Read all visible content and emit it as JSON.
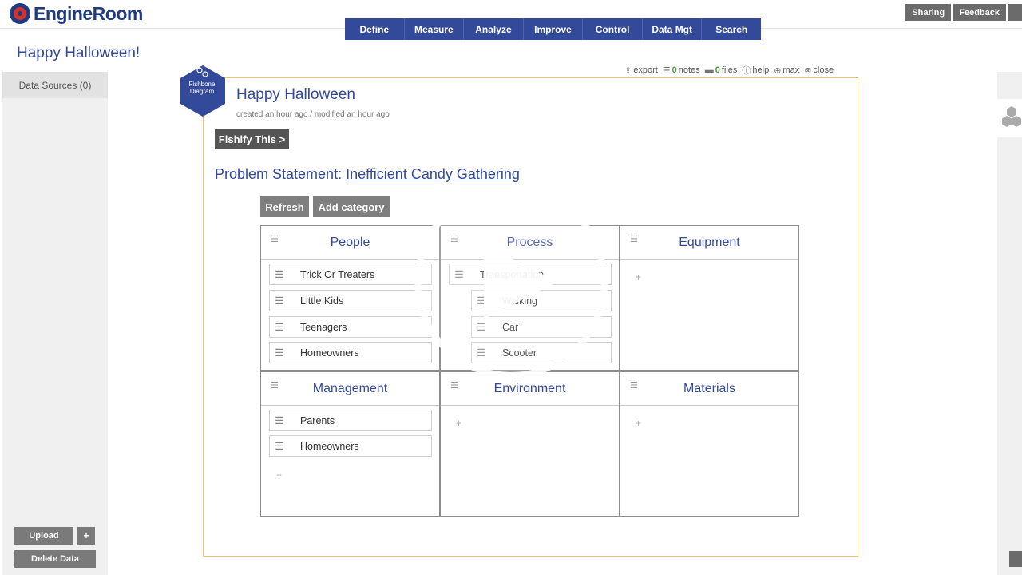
{
  "app": {
    "name": "EngineRoom"
  },
  "header": {
    "right_buttons": [
      "Sharing",
      "Feedback",
      ""
    ],
    "nav": [
      "Define",
      "Measure",
      "Analyze",
      "Improve",
      "Control",
      "Data Mgt",
      "Search"
    ]
  },
  "page": {
    "title": "Happy Halloween!"
  },
  "left_panel": {
    "header": "Data Sources (0)",
    "upload_label": "Upload",
    "plus_label": "+",
    "delete_label": "Delete Data"
  },
  "toolbar": {
    "export": "export",
    "notes_count": "0",
    "notes": "notes",
    "files_count": "0",
    "files": "files",
    "help": "help",
    "max": "max",
    "close": "close"
  },
  "document": {
    "badge_line1": "Fishbone",
    "badge_line2": "Diagram",
    "title": "Happy Halloween",
    "meta": "created an hour ago / modified an hour ago",
    "fishify_label": "Fishify This >",
    "problem_prefix": "Problem Statement:",
    "problem_text": "Inefficient Candy Gathering",
    "refresh_label": "Refresh",
    "add_category_label": "Add category"
  },
  "categories": [
    {
      "name": "People",
      "causes": [
        "Trick Or Treaters",
        "Little Kids",
        "Teenagers",
        "Homeowners"
      ]
    },
    {
      "name": "Process",
      "causes": [
        "Transportation",
        "Walking",
        "Car",
        "Scooter"
      ]
    },
    {
      "name": "Equipment",
      "causes": []
    },
    {
      "name": "Management",
      "causes": [
        "Parents",
        "Homeowners"
      ]
    },
    {
      "name": "Environment",
      "causes": []
    },
    {
      "name": "Materials",
      "causes": []
    }
  ],
  "icons": {
    "logo": "engineroom-gear-logo",
    "play": "play-icon",
    "drag": "drag-handle-icon",
    "hex": "hexagon-cluster-icon"
  },
  "colors": {
    "brand": "#33499a",
    "accent_border": "#f0c064",
    "button_grey": "#7f7f7f"
  }
}
